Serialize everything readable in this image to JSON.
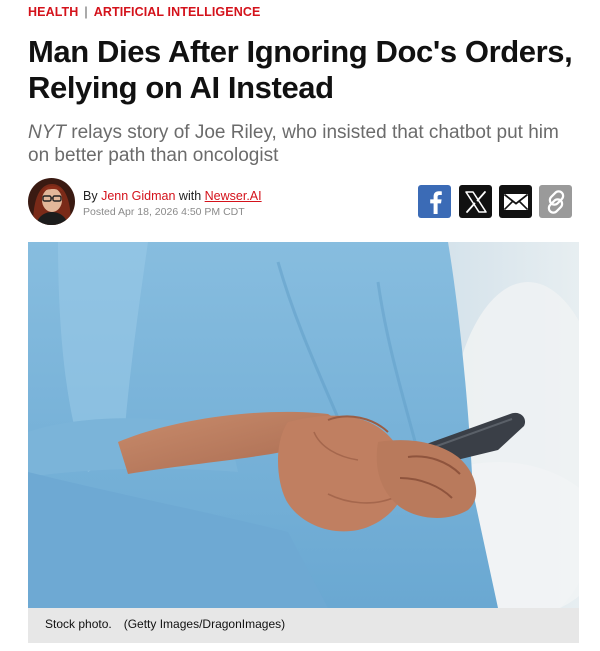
{
  "categories": {
    "primary": "HEALTH",
    "separator": "|",
    "secondary": "ARTIFICIAL INTELLIGENCE"
  },
  "headline": {
    "line1": "Man Dies After Ignoring Doc's Orders,",
    "line2": "Relying on AI Instead"
  },
  "subhead": {
    "source": "NYT",
    "text": " relays story of Joe Riley, who insisted that chatbot put him on better path than oncologist"
  },
  "byline": {
    "by_label": "By",
    "author": "Jenn Gidman",
    "with_label": "with",
    "ai_author": "Newser.AI",
    "posted": "Posted Apr 18, 2026 4:50 PM CDT"
  },
  "share": {
    "icons": [
      "facebook-icon",
      "x-icon",
      "email-icon",
      "link-icon"
    ]
  },
  "photo": {
    "caption": "Stock photo.",
    "credit": "(Getty Images/DragonImages)"
  },
  "colors": {
    "accent_red": "#d4121b",
    "facebook_blue": "#3b6bb6",
    "caption_bg": "#e7e7e7"
  }
}
